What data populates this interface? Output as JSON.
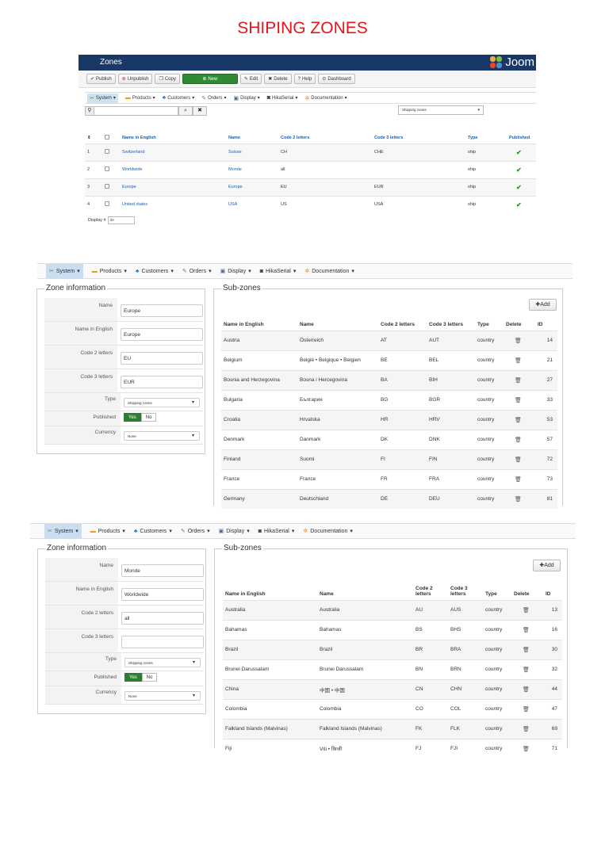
{
  "page_title": "SHIPING ZONES",
  "panel1": {
    "header_title": "Zones",
    "logo_text": "Joom",
    "toolbar": [
      {
        "icon": "check-icon",
        "glyph": "✔",
        "label": "Publish"
      },
      {
        "icon": "unpublish-icon",
        "glyph": "⊗",
        "label": "Unpublish"
      },
      {
        "icon": "copy-icon",
        "glyph": "❐",
        "label": "Copy"
      },
      {
        "icon": "plus-icon",
        "glyph": "⊕",
        "label": "New"
      },
      {
        "icon": "edit-icon",
        "glyph": "✎",
        "label": "Edit"
      },
      {
        "icon": "delete-icon",
        "glyph": "✖",
        "label": "Delete"
      },
      {
        "icon": "help-icon",
        "glyph": "?",
        "label": "Help"
      },
      {
        "icon": "dashboard-icon",
        "glyph": "⊙",
        "label": "Dashboard"
      }
    ],
    "menu": [
      "System",
      "Products",
      "Customers",
      "Orders",
      "Display",
      "HikaSerial",
      "Documentation"
    ],
    "filter_select": "Shipping zones",
    "columns": [
      "#",
      "",
      "Name in English",
      "Name",
      "Code 2 letters",
      "Code 3 letters",
      "Type",
      "Published"
    ],
    "rows": [
      {
        "num": "1",
        "name_en": "Switzerland",
        "name": "Suisse",
        "code2": "CH",
        "code3": "CHE",
        "type": "ship"
      },
      {
        "num": "2",
        "name_en": "Worldwide",
        "name": "Monde",
        "code2": "all",
        "code3": "",
        "type": "ship"
      },
      {
        "num": "3",
        "name_en": "Europe",
        "name": "Europe",
        "code2": "EU",
        "code3": "EUR",
        "type": "ship"
      },
      {
        "num": "4",
        "name_en": "United states",
        "name": "USA",
        "code2": "US",
        "code3": "USA",
        "type": "ship"
      }
    ],
    "display_label": "Display #",
    "display_value": "20"
  },
  "panel2": {
    "menu": [
      "System",
      "Products",
      "Customers",
      "Orders",
      "Display",
      "HikaSerial",
      "Documentation"
    ],
    "zone_legend": "Zone information",
    "subzones_legend": "Sub-zones",
    "form": {
      "name_label": "Name",
      "name_value": "Europe",
      "name_en_label": "Name in English",
      "name_en_value": "Europe",
      "code2_label": "Code 2 letters",
      "code2_value": "EU",
      "code3_label": "Code 3 letters",
      "code3_value": "EUR",
      "type_label": "Type",
      "type_value": "Shipping zones",
      "published_label": "Published",
      "yes": "Yes",
      "no": "No",
      "currency_label": "Currency",
      "currency_value": "None"
    },
    "add_label": "Add",
    "columns": [
      "Name in English",
      "Name",
      "Code 2 letters",
      "Code 3 letters",
      "Type",
      "Delete",
      "ID"
    ],
    "rows": [
      {
        "name_en": "Austria",
        "name": "Österreich",
        "code2": "AT",
        "code3": "AUT",
        "type": "country",
        "id": "14"
      },
      {
        "name_en": "Belgium",
        "name": "België • Belgique • Belgien",
        "code2": "BE",
        "code3": "BEL",
        "type": "country",
        "id": "21"
      },
      {
        "name_en": "Bosnia and Herzegovina",
        "name": "Bosna i Hercegovina",
        "code2": "BA",
        "code3": "BIH",
        "type": "country",
        "id": "27"
      },
      {
        "name_en": "Bulgaria",
        "name": "България",
        "code2": "BG",
        "code3": "BGR",
        "type": "country",
        "id": "33"
      },
      {
        "name_en": "Croatia",
        "name": "Hrvatska",
        "code2": "HR",
        "code3": "HRV",
        "type": "country",
        "id": "53"
      },
      {
        "name_en": "Denmark",
        "name": "Danmark",
        "code2": "DK",
        "code3": "DNK",
        "type": "country",
        "id": "57"
      },
      {
        "name_en": "Finland",
        "name": "Suomi",
        "code2": "FI",
        "code3": "FIN",
        "type": "country",
        "id": "72"
      },
      {
        "name_en": "France",
        "name": "France",
        "code2": "FR",
        "code3": "FRA",
        "type": "country",
        "id": "73"
      },
      {
        "name_en": "Germany",
        "name": "Deutschland",
        "code2": "DE",
        "code3": "DEU",
        "type": "country",
        "id": "81"
      }
    ]
  },
  "panel3": {
    "menu": [
      "System",
      "Products",
      "Customers",
      "Orders",
      "Display",
      "HikaSerial",
      "Documentation"
    ],
    "zone_legend": "Zone information",
    "subzones_legend": "Sub-zones",
    "form": {
      "name_label": "Name",
      "name_value": "Monde",
      "name_en_label": "Name in English",
      "name_en_value": "Worldwide",
      "code2_label": "Code 2 letters",
      "code2_value": "all",
      "code3_label": "Code 3 letters",
      "code3_value": "",
      "type_label": "Type",
      "type_value": "Shipping zones",
      "published_label": "Published",
      "yes": "Yes",
      "no": "No",
      "currency_label": "Currency",
      "currency_value": "None"
    },
    "add_label": "Add",
    "columns": [
      "Name in English",
      "Name",
      "Code 2 letters",
      "Code 3 letters",
      "Type",
      "Delete",
      "ID"
    ],
    "rows": [
      {
        "name_en": "Australia",
        "name": "Australia",
        "code2": "AU",
        "code3": "AUS",
        "type": "country",
        "id": "13"
      },
      {
        "name_en": "Bahamas",
        "name": "Bahamas",
        "code2": "BS",
        "code3": "BHS",
        "type": "country",
        "id": "16"
      },
      {
        "name_en": "Brazil",
        "name": "Brazil",
        "code2": "BR",
        "code3": "BRA",
        "type": "country",
        "id": "30"
      },
      {
        "name_en": "Brunei Darussalam",
        "name": "Brunei Darussalam",
        "code2": "BN",
        "code3": "BRN",
        "type": "country",
        "id": "32"
      },
      {
        "name_en": "China",
        "name": "中国 • 中国",
        "code2": "CN",
        "code3": "CHN",
        "type": "country",
        "id": "44"
      },
      {
        "name_en": "Colombia",
        "name": "Colombia",
        "code2": "CO",
        "code3": "COL",
        "type": "country",
        "id": "47"
      },
      {
        "name_en": "Falkland Islands (Malvinas)",
        "name": "Falkland Islands (Malvinas)",
        "code2": "FK",
        "code3": "FLK",
        "type": "country",
        "id": "69"
      },
      {
        "name_en": "Fiji",
        "name": "Viti • फ़िजी",
        "code2": "FJ",
        "code3": "FJI",
        "type": "country",
        "id": "71"
      }
    ]
  },
  "colors": {
    "title_red": "#e3161a",
    "header_navy": "#1a3867",
    "link_blue": "#1f5fa8",
    "green": "#2e7d32"
  }
}
